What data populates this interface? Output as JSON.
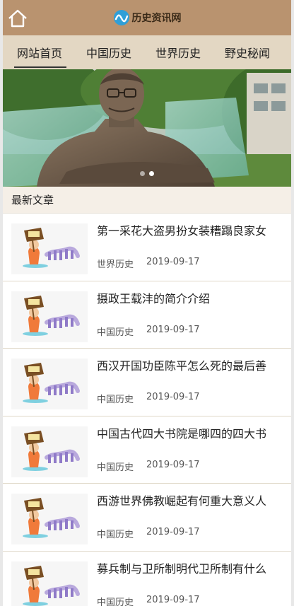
{
  "header": {
    "site_name": "历史资讯网",
    "home_icon": "home-icon",
    "colors": {
      "topbar": "#b9936f",
      "nav": "#e3d7c3",
      "accent": "#333333"
    }
  },
  "nav": {
    "items": [
      {
        "label": "网站首页",
        "active": true
      },
      {
        "label": "中国历史",
        "active": false
      },
      {
        "label": "世界历史",
        "active": false
      },
      {
        "label": "野史秘闻",
        "active": false
      }
    ]
  },
  "banner": {
    "slide_count": 2,
    "active_slide": 1,
    "image": "statue-photo"
  },
  "section": {
    "title": "最新文章"
  },
  "articles": [
    {
      "title": "第一采花大盗男扮女装糟蹋良家女",
      "category": "世界历史",
      "date": "2019-09-17",
      "thumb": "placeholder-image"
    },
    {
      "title": "摄政王载沣的简介介绍",
      "category": "中国历史",
      "date": "2019-09-17",
      "thumb": "placeholder-image"
    },
    {
      "title": "西汉开国功臣陈平怎么死的最后善",
      "category": "中国历史",
      "date": "2019-09-17",
      "thumb": "placeholder-image"
    },
    {
      "title": "中国古代四大书院是哪四的四大书",
      "category": "中国历史",
      "date": "2019-09-17",
      "thumb": "placeholder-image"
    },
    {
      "title": "西游世界佛教崛起有何重大意义人",
      "category": "中国历史",
      "date": "2019-09-17",
      "thumb": "placeholder-image"
    },
    {
      "title": "募兵制与卫所制明代卫所制有什么",
      "category": "中国历史",
      "date": "2019-09-17",
      "thumb": "placeholder-image"
    }
  ]
}
